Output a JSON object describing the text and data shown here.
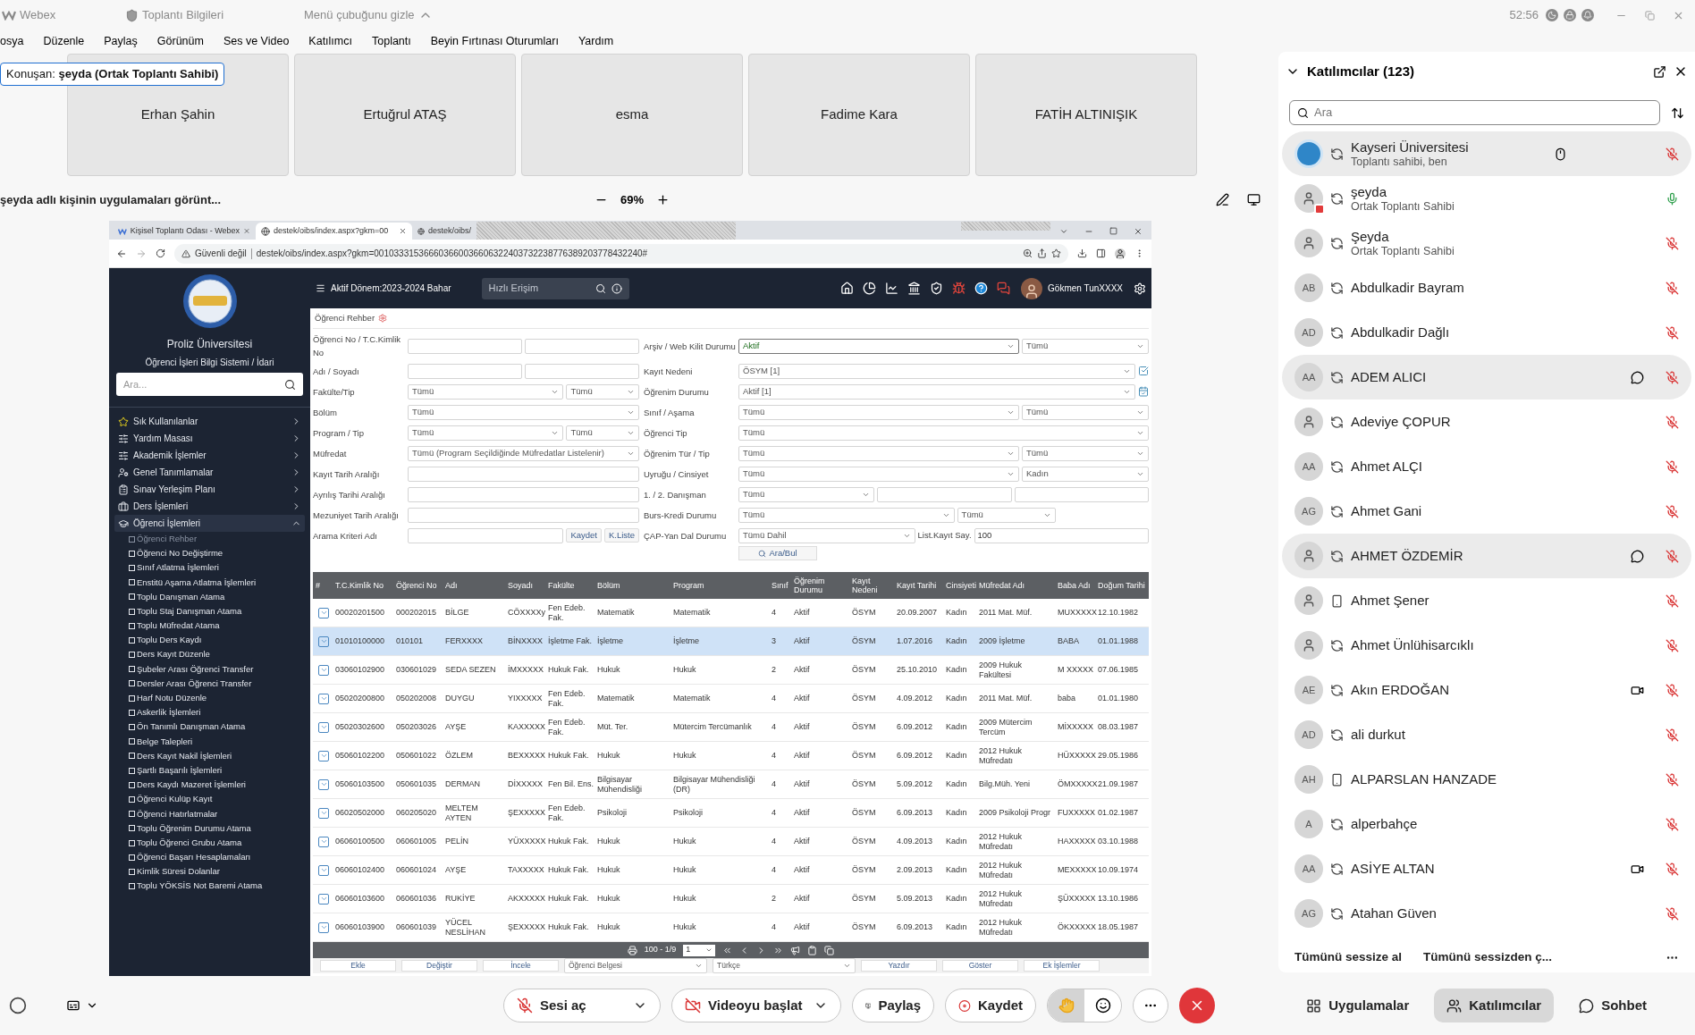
{
  "titlebar": {
    "app": "Webex",
    "meeting_info": "Toplantı Bilgileri",
    "hide_menu": "Menü çubuğunu gizle",
    "timer": "52:56"
  },
  "menu": [
    "osya",
    "Düzenle",
    "Paylaş",
    "Görünüm",
    "Ses ve Video",
    "Katılımcı",
    "Toplantı",
    "Beyin Fırtınası Oturumları",
    "Yardım"
  ],
  "speaker": "Konuşan: **şeyda (Ortak Toplantı Sahibi)**",
  "video_tiles": [
    "Erhan Şahin",
    "Ertuğrul ATAŞ",
    "esma",
    "Fadime Kara",
    "FATİH ALTINIŞIK"
  ],
  "share_bar": {
    "title": "şeyda adlı kişinin uygulamaları görünt...",
    "zoom": "69%"
  },
  "browser": {
    "tabs": [
      {
        "title": "Kişisel Toplantı Odası - Webex",
        "selected": false
      },
      {
        "title": "destek/oibs/index.aspx?gkm=00",
        "selected": true
      },
      {
        "title": "destek/oibs/",
        "selected": false
      }
    ],
    "security": "Güvenli değil",
    "url": "destek/oibs/index.aspx?gkm=001033315366603660036606322403732238776389203778432240#"
  },
  "app": {
    "university": "Proliz Üniversitesi",
    "system": "Öğrenci İşleri Bilgi Sistemi / İdari",
    "search_placeholder": "Ara...",
    "period": "Aktif Dönem:2023-2024 Bahar",
    "quick_access_placeholder": "Hızlı Erişim",
    "user": "Gökmen TunXXXX"
  },
  "sidebar": {
    "items": [
      {
        "label": "Sık Kullanılanlar",
        "expanded": false
      },
      {
        "label": "Yardım Masası",
        "expanded": false
      },
      {
        "label": "Akademik İşlemler",
        "expanded": false
      },
      {
        "label": "Genel Tanımlamalar",
        "expanded": false
      },
      {
        "label": "Sınav Yerleşim Planı",
        "expanded": false
      },
      {
        "label": "Ders İşlemleri",
        "expanded": false
      },
      {
        "label": "Öğrenci İşlemleri",
        "expanded": true,
        "children": [
          {
            "label": "Öğrenci Rehber",
            "selected": true
          },
          {
            "label": "Öğrenci No Değiştirme",
            "selected": false
          },
          {
            "label": "Sınıf Atlatma İşlemleri",
            "selected": false
          },
          {
            "label": "Enstitü Aşama Atlatma İşlemleri",
            "selected": false
          },
          {
            "label": "Toplu Danışman Atama",
            "selected": false
          },
          {
            "label": "Toplu Staj Danışman Atama",
            "selected": false
          },
          {
            "label": "Toplu Müfredat Atama",
            "selected": false
          },
          {
            "label": "Toplu Ders Kaydı",
            "selected": false
          },
          {
            "label": "Ders Kayıt Düzenle",
            "selected": false
          },
          {
            "label": "Şubeler Arası Öğrenci Transfer",
            "selected": false
          },
          {
            "label": "Dersler Arası Öğrenci Transfer",
            "selected": false
          },
          {
            "label": "Harf Notu Düzenle",
            "selected": false
          },
          {
            "label": "Askerlik İşlemleri",
            "selected": false
          },
          {
            "label": "Ön Tanımlı Danışman Atama",
            "selected": false
          },
          {
            "label": "Belge Talepleri",
            "selected": false
          },
          {
            "label": "Ders Kayıt Nakil İşlemleri",
            "selected": false
          },
          {
            "label": "Şartlı Başarılı İşlemleri",
            "selected": false
          },
          {
            "label": "Ders Kaydı Mazeret İşlemleri",
            "selected": false
          },
          {
            "label": "Öğrenci Kulüp Kayıt",
            "selected": false
          },
          {
            "label": "Öğrenci Hatırlatmalar",
            "selected": false
          },
          {
            "label": "Toplu Öğrenim Durumu Atama",
            "selected": false
          },
          {
            "label": "Toplu Öğrenci Grubu Atama",
            "selected": false
          },
          {
            "label": "Öğrenci Başarı Hesaplamaları",
            "selected": false
          },
          {
            "label": "Kimlik Süresi Dolanlar",
            "selected": false
          },
          {
            "label": "Toplu YÖKSİS Not Baremi Atama",
            "selected": false
          }
        ]
      }
    ]
  },
  "page_title": "Öğrenci Rehber",
  "form": {
    "left_fields": [
      {
        "label": "Öğrenci No / T.C.Kimlik No",
        "controls": [
          {
            "kind": "input"
          },
          {
            "kind": "input"
          }
        ]
      },
      {
        "label": "Adı / Soyadı",
        "controls": [
          {
            "kind": "input"
          },
          {
            "kind": "input"
          }
        ]
      },
      {
        "label": "Fakülte/Tip",
        "controls": [
          {
            "kind": "select",
            "value": "Tümü"
          },
          {
            "kind": "select",
            "value": "Tümü"
          }
        ]
      },
      {
        "label": "Bölüm",
        "controls": [
          {
            "kind": "select",
            "value": "Tümü"
          }
        ]
      },
      {
        "label": "Program / Tip",
        "controls": [
          {
            "kind": "select",
            "value": "Tümü"
          },
          {
            "kind": "select",
            "value": "Tümü"
          }
        ]
      },
      {
        "label": "Müfredat",
        "controls": [
          {
            "kind": "select",
            "value": "Tümü (Program Seçildiğinde Müfredatlar Listelenir)"
          }
        ]
      },
      {
        "label": "Kayıt Tarih Aralığı",
        "controls": [
          {
            "kind": "input"
          }
        ]
      },
      {
        "label": "Ayrılış Tarihi Aralığı",
        "controls": [
          {
            "kind": "input"
          }
        ]
      },
      {
        "label": "Mezuniyet Tarih Aralığı",
        "controls": [
          {
            "kind": "input"
          }
        ]
      },
      {
        "label": "Arama Kriteri Adı",
        "controls": [
          {
            "kind": "input"
          },
          {
            "kind": "button",
            "label": "Kaydet"
          },
          {
            "kind": "button",
            "label": "K.Liste"
          }
        ]
      }
    ],
    "right_fields": [
      {
        "label": "Arşiv / Web Kilit Durumu",
        "controls": [
          {
            "kind": "select",
            "value": "Aktif",
            "highlighted": true
          },
          {
            "kind": "select",
            "value": "Tümü"
          }
        ]
      },
      {
        "label": "Kayıt Nedeni",
        "controls": [
          {
            "kind": "select",
            "value": "ÖSYM [1]"
          },
          {
            "kind": "icon_button"
          }
        ]
      },
      {
        "label": "Öğrenim Durumu",
        "controls": [
          {
            "kind": "select",
            "value": "Aktif [1]"
          },
          {
            "kind": "icon_button"
          }
        ]
      },
      {
        "label": "Sınıf / Aşama",
        "controls": [
          {
            "kind": "select",
            "value": "Tümü"
          },
          {
            "kind": "select",
            "value": "Tümü"
          }
        ]
      },
      {
        "label": "Öğrenci Tip",
        "controls": [
          {
            "kind": "select",
            "value": "Tümü"
          }
        ]
      },
      {
        "label": "Öğrenim Tür / Tip",
        "controls": [
          {
            "kind": "select",
            "value": "Tümü"
          },
          {
            "kind": "select",
            "value": "Tümü"
          }
        ]
      },
      {
        "label": "Uyruğu / Cinsiyet",
        "controls": [
          {
            "kind": "select",
            "value": "Tümü"
          },
          {
            "kind": "select",
            "value": "Kadın"
          }
        ]
      },
      {
        "label": "1. / 2. Danışman",
        "controls": [
          {
            "kind": "select",
            "value": "Tümü"
          },
          {
            "kind": "input"
          },
          {
            "kind": "input"
          }
        ]
      },
      {
        "label": "Burs-Kredi Durumu",
        "controls": [
          {
            "kind": "select",
            "value": "Tümü"
          },
          {
            "kind": "select",
            "value": "Tümü"
          },
          {
            "kind": "gap"
          }
        ]
      },
      {
        "label": "ÇAP-Yan Dal Durumu",
        "controls": [
          {
            "kind": "select",
            "value": "Tümü Dahil"
          },
          {
            "kind": "label",
            "text": "List.Kayıt Say."
          },
          {
            "kind": "input",
            "value": "100"
          }
        ]
      }
    ],
    "search_button": "Ara/Bul"
  },
  "table": {
    "index_header": "#",
    "columns": [
      "T.C.Kimlik No",
      "Öğrenci No",
      "Adı",
      "Soyadı",
      "Fakülte",
      "Bölüm",
      "Program",
      "Sınıf",
      "Öğrenim Durumu",
      "Kayıt Nedeni",
      "Kayıt Tarihi",
      "Cinsiyeti",
      "Müfredat Adı",
      "Baba Adı",
      "Doğum Tarihi"
    ],
    "rows": [
      {
        "selected": false,
        "cells": [
          "00020201500",
          "000202015",
          "BİLGE",
          "CÖXXXXy",
          "Fen Edeb. Fak.",
          "Matematik",
          "Matematik",
          "4",
          "Aktif",
          "ÖSYM",
          "20.09.2007",
          "Kadın",
          "2011 Mat. Müf.",
          "MUXXXXX",
          "12.10.1982"
        ]
      },
      {
        "selected": true,
        "cells": [
          "01010100000",
          "010101",
          "FERXXXX",
          "BİNXXXX",
          "İşletme Fak.",
          "İşletme",
          "İşletme",
          "3",
          "Aktif",
          "ÖSYM",
          "1.07.2016",
          "Kadın",
          "2009 İşletme",
          "BABA",
          "01.01.1988"
        ]
      },
      {
        "selected": false,
        "cells": [
          "03060102900",
          "030601029",
          "SEDA SEZEN",
          "İMXXXXX",
          "Hukuk Fak.",
          "Hukuk",
          "Hukuk",
          "2",
          "Aktif",
          "ÖSYM",
          "25.10.2010",
          "Kadın",
          "2009 Hukuk Fakültesi",
          "M XXXXX",
          "07.06.1985"
        ]
      },
      {
        "selected": false,
        "cells": [
          "05020200800",
          "050202008",
          "DUYGU",
          "YIXXXXX",
          "Fen Edeb. Fak.",
          "Matematik",
          "Matematik",
          "4",
          "Aktif",
          "ÖSYM",
          "4.09.2012",
          "Kadın",
          "2011 Mat. Müf.",
          "baba",
          "01.01.1980"
        ]
      },
      {
        "selected": false,
        "cells": [
          "05020302600",
          "050203026",
          "AYŞE",
          "KAXXXXX",
          "Fen Edeb. Fak.",
          "Müt. Ter.",
          "Mütercim Tercümanlık",
          "4",
          "Aktif",
          "ÖSYM",
          "6.09.2012",
          "Kadın",
          "2009 Mütercim Tercüm",
          "MİXXXXX",
          "08.03.1987"
        ]
      },
      {
        "selected": false,
        "cells": [
          "05060102200",
          "050601022",
          "ÖZLEM",
          "BEXXXXX",
          "Hukuk Fak.",
          "Hukuk",
          "Hukuk",
          "4",
          "Aktif",
          "ÖSYM",
          "6.09.2012",
          "Kadın",
          "2012 Hukuk Müfredatı",
          "HÜXXXXX",
          "29.05.1986"
        ]
      },
      {
        "selected": false,
        "cells": [
          "05060103500",
          "050601035",
          "DERMAN",
          "DİXXXXX",
          "Fen Bil. Ens.",
          "Bilgisayar Mühendisliği",
          "Bilgisayar Mühendisliği (DR)",
          "4",
          "Aktif",
          "ÖSYM",
          "5.09.2012",
          "Kadın",
          "Bilg.Müh. Yeni",
          "ÖMXXXXX",
          "21.09.1987"
        ]
      },
      {
        "selected": false,
        "cells": [
          "06020502000",
          "060205020",
          "MELTEM AYTEN",
          "ŞEXXXXX",
          "Fen Edeb. Fak.",
          "Psikoloji",
          "Psikoloji",
          "4",
          "Aktif",
          "ÖSYM",
          "6.09.2013",
          "Kadın",
          "2009 Psikoloji Progr",
          "FUXXXXX",
          "01.02.1987"
        ]
      },
      {
        "selected": false,
        "cells": [
          "06060100500",
          "060601005",
          "PELİN",
          "YÜXXXXX",
          "Hukuk Fak.",
          "Hukuk",
          "Hukuk",
          "4",
          "Aktif",
          "ÖSYM",
          "4.09.2013",
          "Kadın",
          "2012 Hukuk Müfredatı",
          "HAXXXXX",
          "03.10.1988"
        ]
      },
      {
        "selected": false,
        "cells": [
          "06060102400",
          "060601024",
          "AYŞE",
          "TAXXXXX",
          "Hukuk Fak.",
          "Hukuk",
          "Hukuk",
          "4",
          "Aktif",
          "ÖSYM",
          "2.09.2013",
          "Kadın",
          "2012 Hukuk Müfredatı",
          "MEXXXXX",
          "10.09.1974"
        ]
      },
      {
        "selected": false,
        "cells": [
          "06060103600",
          "060601036",
          "RUKİYE",
          "AKXXXXX",
          "Hukuk Fak.",
          "Hukuk",
          "Hukuk",
          "2",
          "Aktif",
          "ÖSYM",
          "5.09.2013",
          "Kadın",
          "2012 Hukuk Müfredatı",
          "ŞÜXXXXX",
          "13.10.1986"
        ]
      },
      {
        "selected": false,
        "cells": [
          "06060103900",
          "060601039",
          "YÜCEL NESLİHAN",
          "ŞEXXXXX",
          "Hukuk Fak.",
          "Hukuk",
          "Hukuk",
          "4",
          "Aktif",
          "ÖSYM",
          "6.09.2013",
          "Kadın",
          "2012 Hukuk Müfredatı",
          "ÖKXXXXX",
          "18.05.1987"
        ]
      }
    ],
    "pager": {
      "range": "100 - 1/9",
      "page": "1"
    },
    "actions": [
      {
        "kind": "button",
        "label": "Ekle"
      },
      {
        "kind": "button",
        "label": "Değiştir"
      },
      {
        "kind": "button",
        "label": "İncele"
      },
      {
        "kind": "select",
        "value": "Öğrenci Belgesi"
      },
      {
        "kind": "select",
        "value": "Türkçe"
      },
      {
        "kind": "button",
        "label": "Yazdır"
      },
      {
        "kind": "button",
        "label": "Göster"
      },
      {
        "kind": "button",
        "label": "Ek İşlemler"
      }
    ]
  },
  "participants": {
    "title": "Katılımcılar (123)",
    "search_placeholder": "Ara",
    "items": [
      {
        "name": "Kayseri Üniversitesi",
        "role": "Toplantı sahibi, ben",
        "avatar": {
          "kind": "logo"
        },
        "audio": {
          "kind": "computer"
        },
        "muted": true,
        "highlighted": true,
        "status": {
          "kind": "remote"
        }
      },
      {
        "name": "şeyda",
        "role": "Ortak Toplantı Sahibi",
        "avatar": {
          "kind": "sharing"
        },
        "audio": {
          "kind": "computer"
        },
        "muted": false,
        "highlighted": false
      },
      {
        "name": "Şeyda",
        "role": "Ortak Toplantı Sahibi",
        "avatar": {
          "kind": "person"
        },
        "audio": {
          "kind": "computer"
        },
        "muted": true,
        "highlighted": false
      },
      {
        "name": "Abdulkadir Bayram",
        "avatar": {
          "kind": "initials",
          "initials": "AB"
        },
        "audio": {
          "kind": "computer"
        },
        "muted": true,
        "highlighted": false
      },
      {
        "name": "Abdulkadir Dağlı",
        "avatar": {
          "kind": "initials",
          "initials": "AD"
        },
        "audio": {
          "kind": "computer"
        },
        "muted": true,
        "highlighted": false
      },
      {
        "name": "ADEM ALICI",
        "avatar": {
          "kind": "initials",
          "initials": "AA"
        },
        "audio": {
          "kind": "computer"
        },
        "muted": true,
        "highlighted": true,
        "status": {
          "kind": "chat"
        }
      },
      {
        "name": "Adeviye ÇOPUR",
        "avatar": {
          "kind": "person"
        },
        "audio": {
          "kind": "computer"
        },
        "muted": true,
        "highlighted": false
      },
      {
        "name": "Ahmet ALÇI",
        "avatar": {
          "kind": "initials",
          "initials": "AA"
        },
        "audio": {
          "kind": "computer"
        },
        "muted": true,
        "highlighted": false
      },
      {
        "name": "Ahmet Gani",
        "avatar": {
          "kind": "initials",
          "initials": "AG"
        },
        "audio": {
          "kind": "computer"
        },
        "muted": true,
        "highlighted": false
      },
      {
        "name": "AHMET ÖZDEMİR",
        "avatar": {
          "kind": "person"
        },
        "audio": {
          "kind": "computer"
        },
        "muted": true,
        "highlighted": true,
        "status": {
          "kind": "chat"
        }
      },
      {
        "name": "Ahmet Şener",
        "avatar": {
          "kind": "person"
        },
        "audio": {
          "kind": "phone"
        },
        "muted": true,
        "highlighted": false
      },
      {
        "name": "Ahmet Ünlühisarcıklı",
        "avatar": {
          "kind": "person"
        },
        "audio": {
          "kind": "computer"
        },
        "muted": true,
        "highlighted": false
      },
      {
        "name": "Akın ERDOĞAN",
        "avatar": {
          "kind": "initials",
          "initials": "AE"
        },
        "audio": {
          "kind": "computer"
        },
        "muted": true,
        "highlighted": false,
        "status": {
          "kind": "video"
        }
      },
      {
        "name": "ali durkut",
        "avatar": {
          "kind": "initials",
          "initials": "AD"
        },
        "audio": {
          "kind": "computer"
        },
        "muted": true,
        "highlighted": false
      },
      {
        "name": "ALPARSLAN HANZADE",
        "avatar": {
          "kind": "initials",
          "initials": "AH"
        },
        "audio": {
          "kind": "phone"
        },
        "muted": true,
        "highlighted": false
      },
      {
        "name": "alperbahçe",
        "avatar": {
          "kind": "initials",
          "initials": "A"
        },
        "audio": {
          "kind": "computer"
        },
        "muted": true,
        "highlighted": false
      },
      {
        "name": "ASİYE ALTAN",
        "avatar": {
          "kind": "initials",
          "initials": "AA"
        },
        "audio": {
          "kind": "computer"
        },
        "muted": true,
        "highlighted": false,
        "status": {
          "kind": "video"
        }
      },
      {
        "name": "Atahan Güven",
        "avatar": {
          "kind": "initials",
          "initials": "AG"
        },
        "audio": {
          "kind": "computer"
        },
        "muted": true,
        "highlighted": false
      }
    ],
    "mute_all": "Tümünü sessize al",
    "unmute_all": "Tümünü sessizden ç..."
  },
  "controls": {
    "unmute": "Sesi aç",
    "start_video": "Videoyu başlat",
    "share": "Paylaş",
    "record": "Kaydet",
    "hand_raised": true
  },
  "panel_tabs": [
    {
      "label": "Uygulamalar",
      "selected": false
    },
    {
      "label": "Katılımcılar",
      "selected": true
    },
    {
      "label": "Sohbet",
      "selected": false
    }
  ]
}
